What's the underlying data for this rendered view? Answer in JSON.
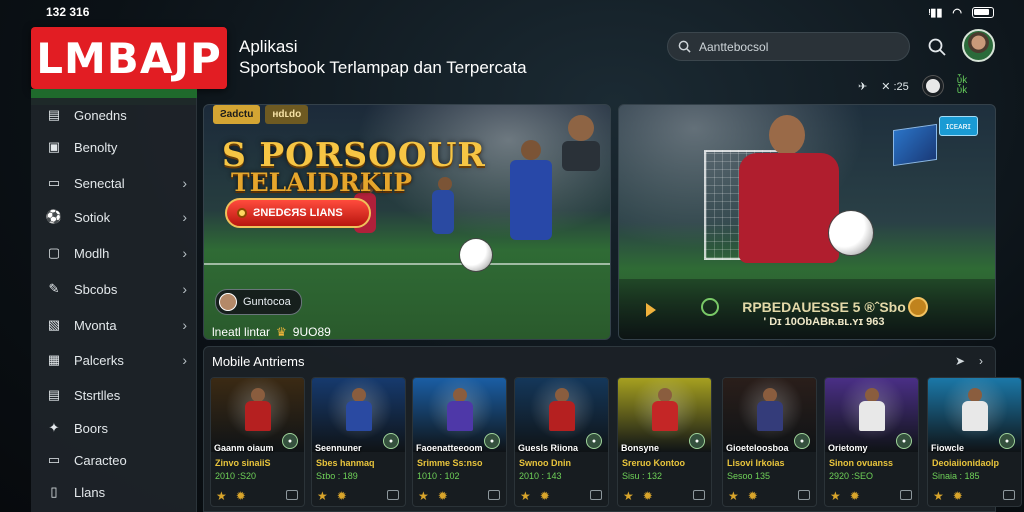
{
  "status": {
    "time": "132 316",
    "icons": "✈ ▌▌ ◠"
  },
  "brand": {
    "logo": "LMBAJP",
    "tagline_1": "Aplikasi",
    "tagline_2": "Sportsbook Terlampap dan Terpercata"
  },
  "search": {
    "value": "Aanttebocsol",
    "icon": "search-icon"
  },
  "toolbar": {
    "item_1": "✈",
    "item_2": "✕ :25",
    "live_label_1": "ὗk",
    "live_label_2": "ὗk"
  },
  "sidebar": {
    "items": [
      {
        "label": "Gonedns",
        "icon": "list-icon",
        "chevron": false
      },
      {
        "label": "Benolty",
        "icon": "chat-icon",
        "chevron": false
      },
      {
        "label": "Senectal",
        "icon": "folder-icon",
        "chevron": true
      },
      {
        "label": "Sotiok",
        "icon": "football-icon",
        "chevron": true
      },
      {
        "label": "Modlh",
        "icon": "monitor-icon",
        "chevron": true
      },
      {
        "label": "Sbcobs",
        "icon": "pencil-icon",
        "chevron": true
      },
      {
        "label": "Mvonta",
        "icon": "image-icon",
        "chevron": true
      },
      {
        "label": "Palcerks",
        "icon": "grid-icon",
        "chevron": true
      },
      {
        "label": "Stsrtlles",
        "icon": "document-icon",
        "chevron": false
      },
      {
        "label": "Boors",
        "icon": "pin-icon",
        "chevron": false
      },
      {
        "label": "Caracteo",
        "icon": "card-icon",
        "chevron": false
      },
      {
        "label": "Llans",
        "icon": "file-icon",
        "chevron": false
      }
    ]
  },
  "hero_left": {
    "tag_1": "Ƨadctu",
    "tag_2": "ʜdʟdo",
    "title": "S PORSOOUR",
    "subtitle": "TELAIDRKIP",
    "cta": "ƧNEDЄЯS LIANS",
    "badge": "Guntocoa",
    "caption": "lneatl lintar",
    "caption_value": "9UO89"
  },
  "hero_right": {
    "tv_badge": "ɪᴄᴇᴀʀɪ",
    "promo_title": "RPBEDAUESSE 5 ®ˆSbo",
    "promo_sub": "' Dɪ 10ObABʀ.ʙʟ.ʏɪ 963"
  },
  "games": {
    "section_title": "Mobile Antriems",
    "cards": [
      {
        "name": "Gaanm oiaum",
        "players": "Zinvo sinaiiS",
        "odds": "2010 :S20",
        "art": "#3b2a14",
        "jersey": "#b52020"
      },
      {
        "name": "Seennuner",
        "players": "Sbes hanmaq",
        "odds": "Sɪbo : 189",
        "art": "#163a6e",
        "jersey": "#2a4aa2"
      },
      {
        "name": "Faoenatteeoom",
        "players": "Srimme Ss:nso",
        "odds": "1010 : 102",
        "art": "#1a5ea4",
        "jersey": "#4e38a8"
      },
      {
        "name": "Guesls Riiona",
        "players": "Swnoo Dnin",
        "odds": "2010 : 143",
        "art": "#14375a",
        "jersey": "#b52020"
      },
      {
        "name": "Bonsyne",
        "players": "Sreruo Kontoo",
        "odds": "Sisu : 132",
        "art": "#a6a020",
        "jersey": "#c42626"
      },
      {
        "name": "Gioeteloosboa",
        "players": "Lisovi Irkoias",
        "odds": "Sesoo 135",
        "art": "#2a1e1a",
        "jersey": "#343c7a"
      },
      {
        "name": "Orietomy",
        "players": "Sinon ovuanss",
        "odds": "2920 :SEO",
        "art": "#4a2f86",
        "jersey": "#e8e8e8"
      },
      {
        "name": "Fiowcle",
        "players": "Deoiaiionidaolp",
        "odds": "Sinaia : 185",
        "art": "#1b78a8",
        "jersey": "#e8e8e8"
      }
    ]
  }
}
